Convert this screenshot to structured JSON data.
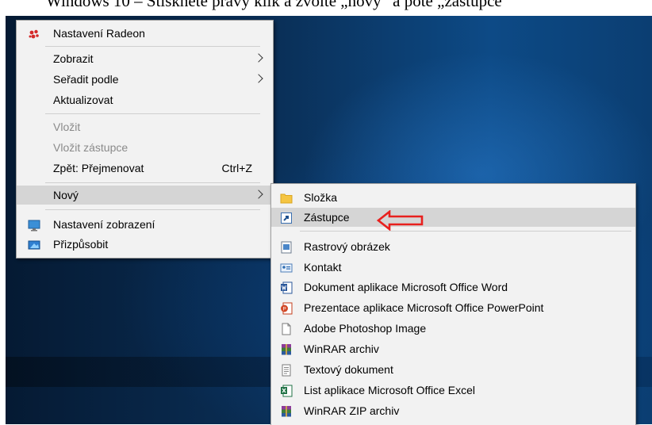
{
  "caption": "Windows 10 – Stiskněte pravý klik a zvolte „nový“ a poté „zástupce“",
  "context_menu": {
    "items": [
      {
        "label": "Nastavení Radeon",
        "icon": "radeon-icon"
      },
      {
        "label": "Zobrazit",
        "submenu": true
      },
      {
        "label": "Seřadit podle",
        "submenu": true
      },
      {
        "label": "Aktualizovat"
      },
      {
        "label": "Vložit",
        "disabled": true
      },
      {
        "label": "Vložit zástupce",
        "disabled": true
      },
      {
        "label": "Zpět: Přejmenovat",
        "shortcut": "Ctrl+Z"
      },
      {
        "label": "Nový",
        "submenu": true,
        "highlighted": true
      },
      {
        "label": "Nastavení zobrazení",
        "icon": "display-settings-icon"
      },
      {
        "label": "Přizpůsobit",
        "icon": "personalize-icon"
      }
    ]
  },
  "new_submenu": {
    "items": [
      {
        "label": "Složka",
        "icon": "folder-icon"
      },
      {
        "label": "Zástupce",
        "icon": "shortcut-icon",
        "highlighted": true
      },
      {
        "label": "Rastrový obrázek",
        "icon": "bitmap-image-icon"
      },
      {
        "label": "Kontakt",
        "icon": "contact-icon"
      },
      {
        "label": "Dokument aplikace Microsoft Office Word",
        "icon": "word-document-icon"
      },
      {
        "label": "Prezentace aplikace Microsoft Office PowerPoint",
        "icon": "powerpoint-icon"
      },
      {
        "label": "Adobe Photoshop Image",
        "icon": "photoshop-file-icon"
      },
      {
        "label": "WinRAR archiv",
        "icon": "winrar-icon"
      },
      {
        "label": "Textový dokument",
        "icon": "text-document-icon"
      },
      {
        "label": "List aplikace Microsoft Office Excel",
        "icon": "excel-icon"
      },
      {
        "label": "WinRAR ZIP archiv",
        "icon": "winrar-zip-icon"
      }
    ]
  },
  "annotation": {
    "arrow_color": "#e8201e",
    "points_to": "Zástupce"
  },
  "colors": {
    "menu_bg": "#f2f2f2",
    "highlight": "#d5d5d5",
    "disabled_text": "#8a8a8a"
  }
}
